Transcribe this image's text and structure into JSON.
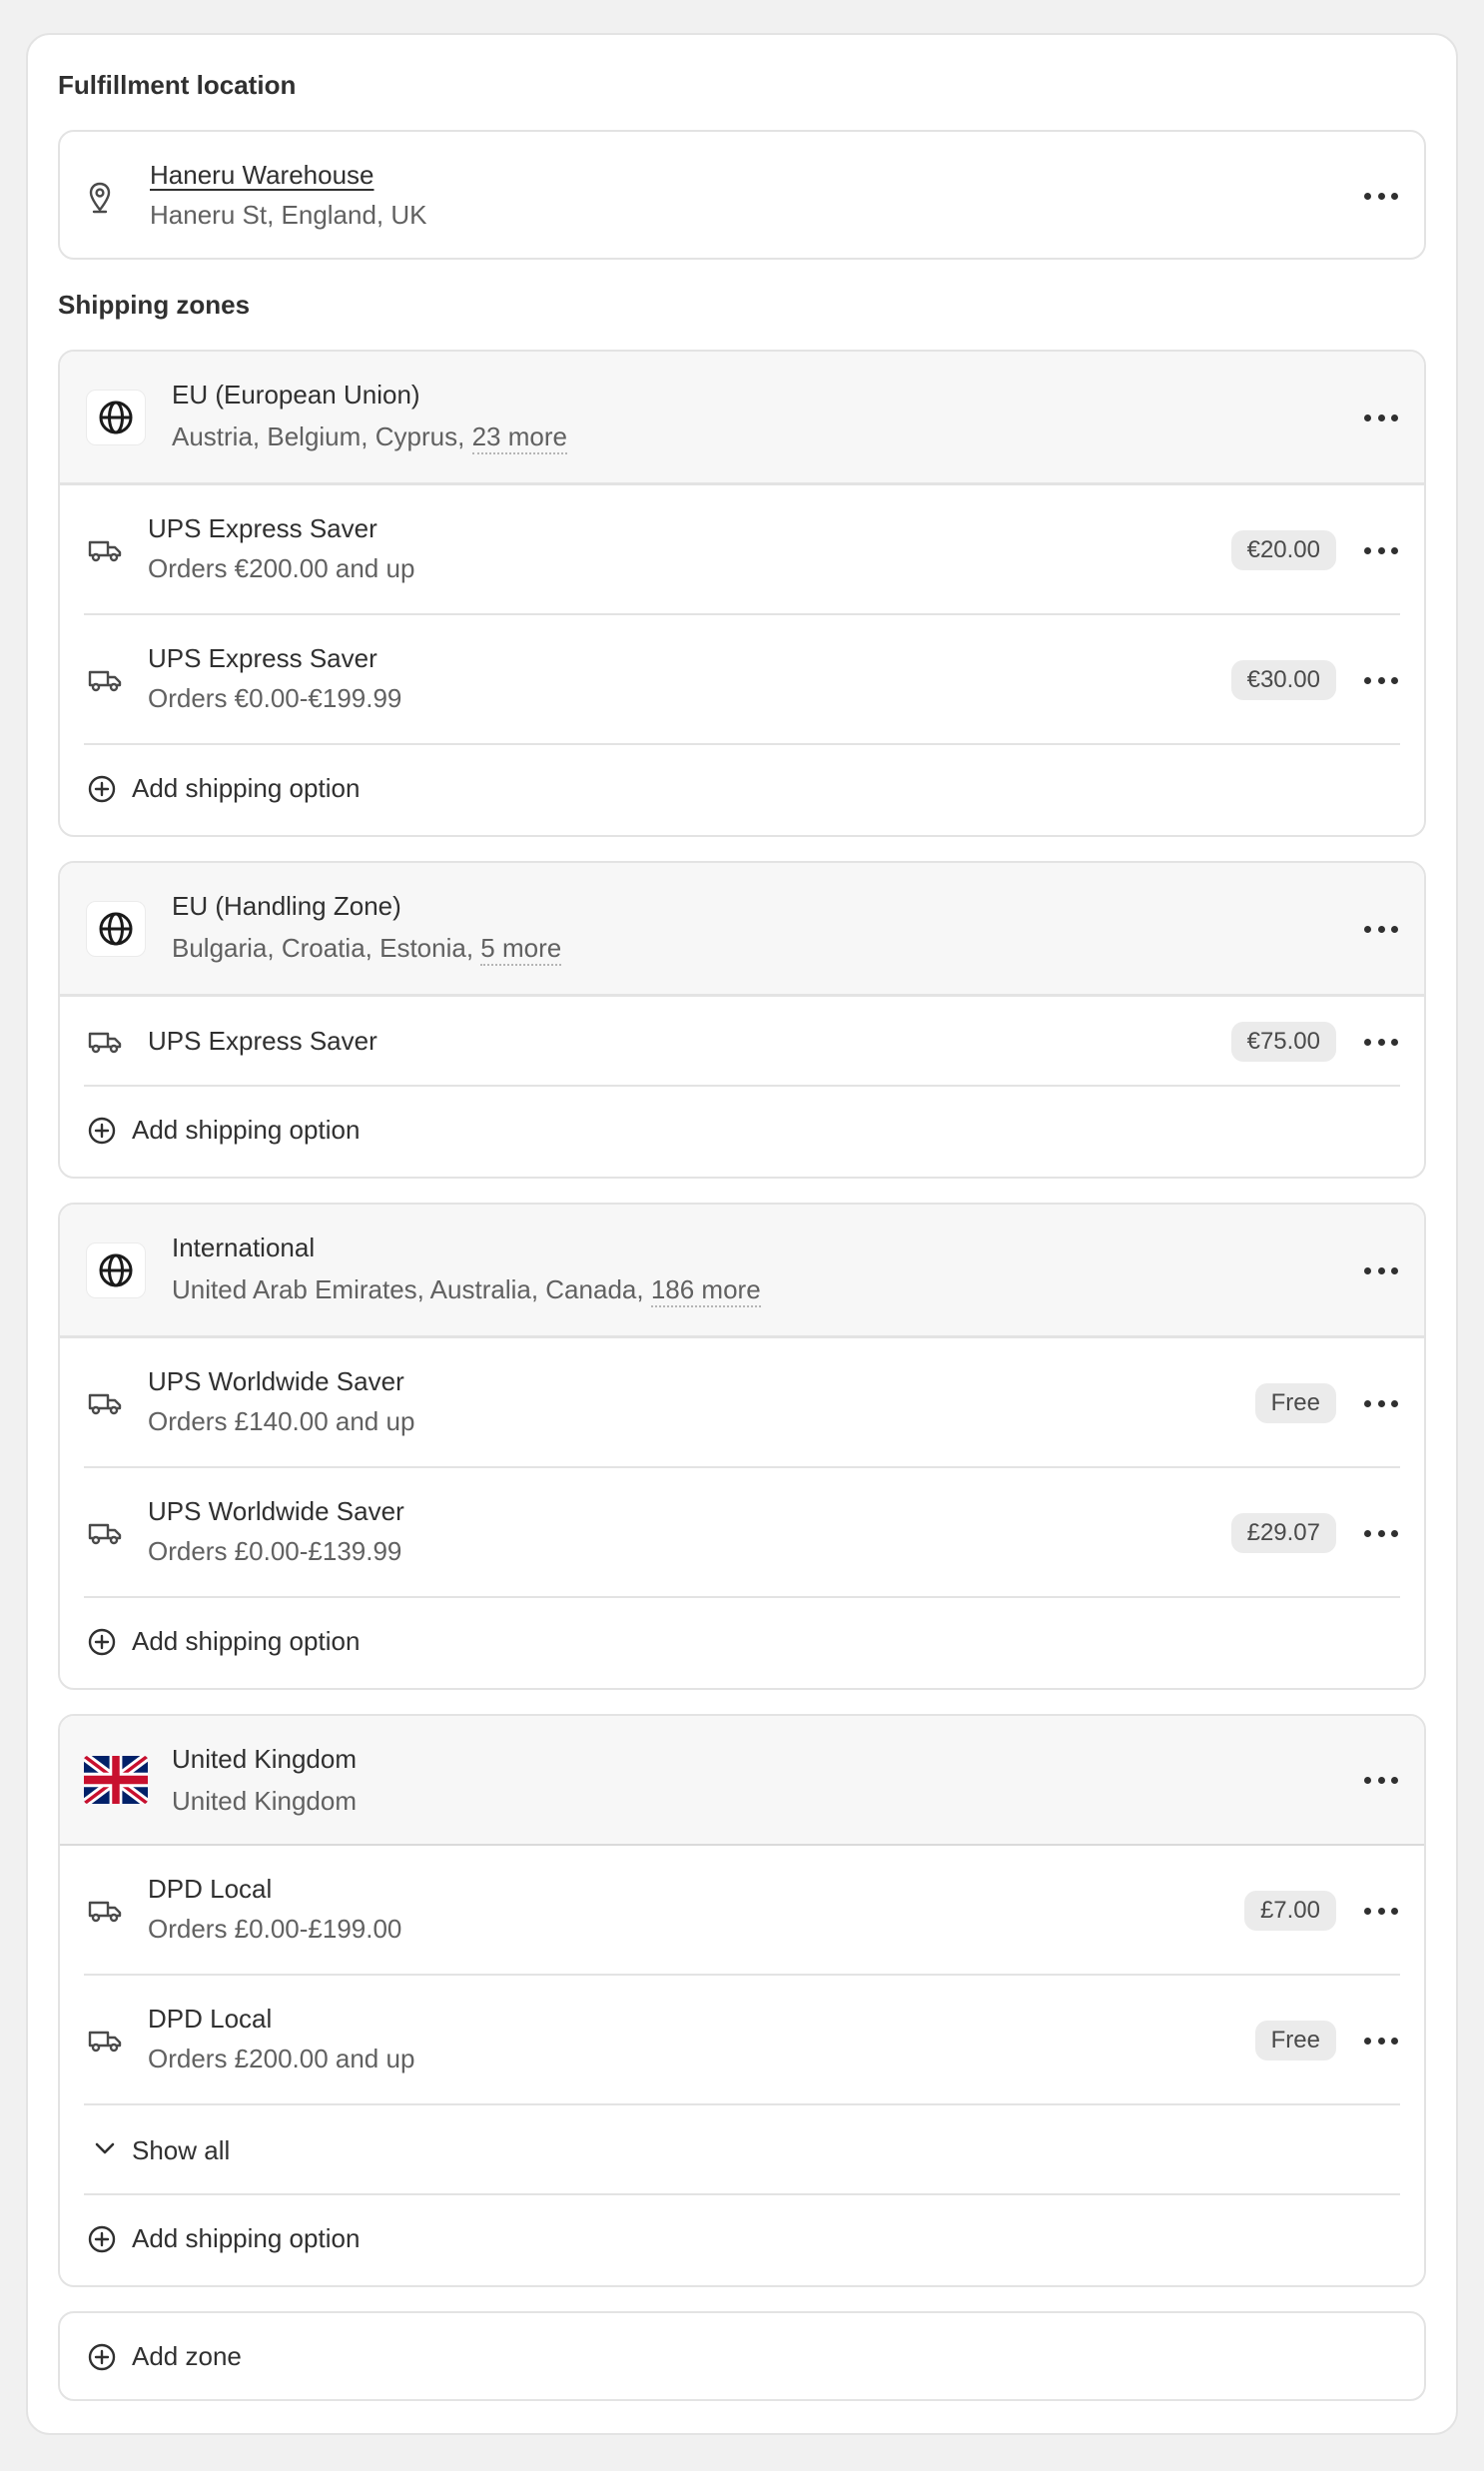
{
  "fulfillment": {
    "heading": "Fulfillment location",
    "location_name": "Haneru Warehouse",
    "location_address": "Haneru St, England, UK"
  },
  "shipping_zones_heading": "Shipping zones",
  "add_shipping_option_label": "Add shipping option",
  "zones": [
    {
      "name": "EU (European Union)",
      "countries": "Austria, Belgium, Cyprus,",
      "more": "23 more",
      "rates": [
        {
          "name": "UPS Express Saver",
          "condition": "Orders €200.00 and up",
          "price": "€20.00"
        },
        {
          "name": "UPS Express Saver",
          "condition": "Orders €0.00-€199.99",
          "price": "€30.00"
        }
      ]
    },
    {
      "name": "EU (Handling Zone)",
      "countries": "Bulgaria, Croatia, Estonia,",
      "more": "5 more",
      "rates": [
        {
          "name": "UPS Express Saver",
          "condition": "",
          "price": "€75.00"
        }
      ]
    },
    {
      "name": "International",
      "countries": "United Arab Emirates, Australia, Canada,",
      "more": "186 more",
      "rates": [
        {
          "name": "UPS Worldwide Saver",
          "condition": "Orders £140.00 and up",
          "price": "Free"
        },
        {
          "name": "UPS Worldwide Saver",
          "condition": "Orders £0.00-£139.99",
          "price": "£29.07"
        }
      ]
    },
    {
      "name": "United Kingdom",
      "countries": "United Kingdom",
      "more": "",
      "rates": [
        {
          "name": "DPD Local",
          "condition": "Orders £0.00-£199.00",
          "price": "£7.00"
        },
        {
          "name": "DPD Local",
          "condition": "Orders £200.00 and up",
          "price": "Free"
        }
      ],
      "show_all_label": "Show all"
    }
  ],
  "add_zone_label": "Add zone",
  "icons": {
    "location": "map-pin-icon",
    "zone": "globe-icon",
    "rate": "truck-icon",
    "add": "plus-circle-icon",
    "menu": "ellipsis-icon",
    "expand": "chevron-down-icon",
    "flag": "uk-flag-icon"
  }
}
